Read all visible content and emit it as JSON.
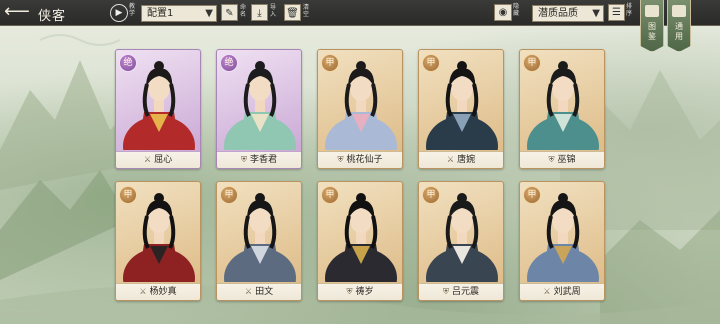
{
  "header": {
    "title": "侠客",
    "tutorial_label": "教学",
    "preset_value": "配置1",
    "tools": [
      {
        "icon": "brush-icon",
        "label": "命名"
      },
      {
        "icon": "import-icon",
        "label": "导入"
      },
      {
        "icon": "trash-icon",
        "label": "清空"
      }
    ],
    "hide_label": "隐藏",
    "sort_value": "潜质品质",
    "sort_label": "排序"
  },
  "side_tabs": [
    {
      "label": "图鉴",
      "icon": "book-icon"
    },
    {
      "label": "通用",
      "icon": "scroll-icon"
    }
  ],
  "colors": {
    "topbar": "#2a2a28",
    "card_gold": "#dcb882",
    "card_purple": "#c6a2d2",
    "tab_green": "#4f6647"
  },
  "cards": [
    {
      "name": "屈心",
      "grade": "绝",
      "tier": "purple",
      "role_icon": "sword-icon",
      "role": "⚔",
      "hair": "#1d1a1a",
      "robe": "#b32a2a",
      "accent": "#e6b34a"
    },
    {
      "name": "李香君",
      "grade": "绝",
      "tier": "purple",
      "role_icon": "shield-icon",
      "role": "⛨",
      "hair": "#1c1b1d",
      "robe": "#8fc7b2",
      "accent": "#e9e2c6"
    },
    {
      "name": "桃花仙子",
      "grade": "甲",
      "tier": "gold",
      "role_icon": "shield-icon",
      "role": "⛨",
      "hair": "#1d1a1c",
      "robe": "#a9b9d6",
      "accent": "#e7b0c0"
    },
    {
      "name": "唐婉",
      "grade": "甲",
      "tier": "gold",
      "role_icon": "sword-icon",
      "role": "⚔",
      "hair": "#141414",
      "robe": "#2a3b4a",
      "accent": "#8aa0b6"
    },
    {
      "name": "巫锦",
      "grade": "甲",
      "tier": "gold",
      "role_icon": "shield-icon",
      "role": "⛨",
      "hair": "#1a1c1c",
      "robe": "#4c8f8c",
      "accent": "#cfe3d9"
    },
    {
      "name": "杨妙真",
      "grade": "甲",
      "tier": "gold",
      "role_icon": "sword-icon",
      "role": "⚔",
      "hair": "#121212",
      "robe": "#8e2222",
      "accent": "#2b2323"
    },
    {
      "name": "田文",
      "grade": "甲",
      "tier": "gold",
      "role_icon": "sword-icon",
      "role": "⚔",
      "hair": "#161616",
      "robe": "#5d6b80",
      "accent": "#cfd6de"
    },
    {
      "name": "祷岁",
      "grade": "甲",
      "tier": "gold",
      "role_icon": "shield-icon",
      "role": "⛨",
      "hair": "#111111",
      "robe": "#2a2a30",
      "accent": "#c7a24a"
    },
    {
      "name": "吕元震",
      "grade": "甲",
      "tier": "gold",
      "role_icon": "shield-icon",
      "role": "⛨",
      "hair": "#1a1a1a",
      "robe": "#3a4552",
      "accent": "#e9e6df"
    },
    {
      "name": "刘武周",
      "grade": "甲",
      "tier": "gold",
      "role_icon": "sword-icon",
      "role": "⚔",
      "hair": "#151515",
      "robe": "#6d86a8",
      "accent": "#c9a45a"
    }
  ]
}
